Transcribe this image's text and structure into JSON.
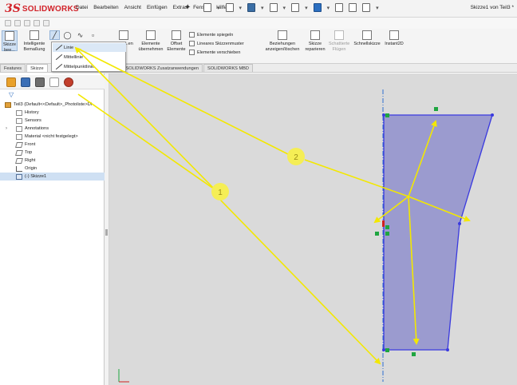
{
  "app": {
    "logo_ds": "3S",
    "logo_text": "SOLIDWORKS",
    "document_title": "Skizze1 von Teil3 *"
  },
  "menu": [
    "Datei",
    "Bearbeiten",
    "Ansicht",
    "Einfügen",
    "Extras",
    "Fenster",
    "Hilfe"
  ],
  "ribbon": {
    "sketch_exit": "Skizze bee...",
    "smart_dimension": "Intelligente Bemaßung",
    "convert_entities": "Elemente übernehmen",
    "offset_entities": "Offset Elemente",
    "mirror_entities": "Elemente spiegeln",
    "linear_pattern": "Lineares Skizzenmuster",
    "move_entities": "Elemente verschieben",
    "relations": "Beziehungen anzeigen/löschen",
    "repair_sketch": "Skizze reparieren",
    "shaded_sketch": "Schattierte Flügen",
    "quick_snaps": "Schnellskizze",
    "instant2d": "Instant2D",
    "partial_label": "Ente ...en"
  },
  "line_dropdown": {
    "items": [
      "Linie",
      "Mittellinie",
      "Mittelpunktlinie"
    ]
  },
  "cm_tabs": [
    "Features",
    "Skizze",
    "SOLIDWORKS Zusatzanwendungen",
    "SOLIDWORKS MBD"
  ],
  "feature_tree": {
    "part": "Teil3 (Default<<Default>_Photoliste>Di",
    "items": [
      "History",
      "Sensors",
      "Annotations",
      "Material <nicht festgelegt>",
      "Front",
      "Top",
      "Right",
      "Origin",
      "(-) Skizze1"
    ]
  },
  "callouts": [
    "1",
    "2"
  ],
  "colors": {
    "accent_yellow": "#f5ee55",
    "arrow_yellow": "#f3e800",
    "sketch_fill": "#9b9bcf",
    "sketch_edge": "#3a3adf",
    "centerline": "#2f6fd0",
    "constraint_green": "#1fa540",
    "brand_red": "#d2232a"
  }
}
